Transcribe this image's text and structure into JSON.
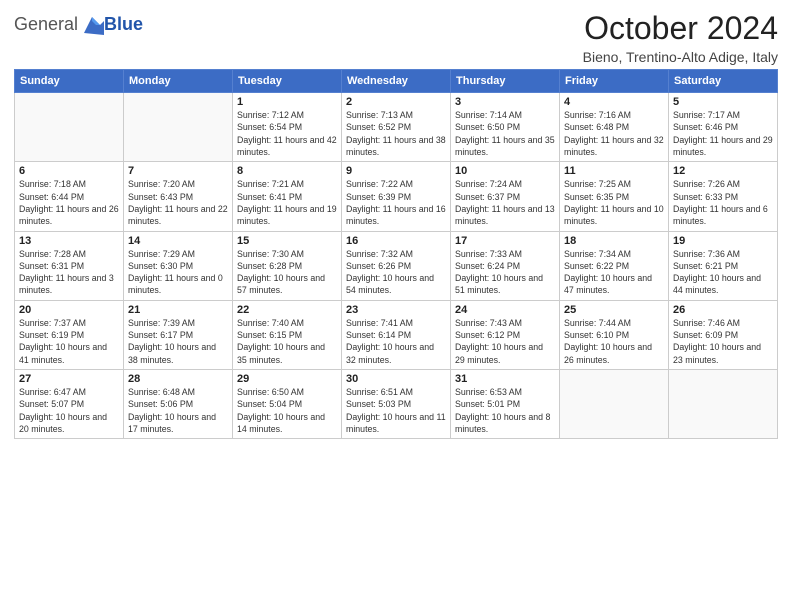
{
  "header": {
    "logo": {
      "text_general": "General",
      "text_blue": "Blue"
    },
    "month_title": "October 2024",
    "location": "Bieno, Trentino-Alto Adige, Italy"
  },
  "weekdays": [
    "Sunday",
    "Monday",
    "Tuesday",
    "Wednesday",
    "Thursday",
    "Friday",
    "Saturday"
  ],
  "weeks": [
    [
      {
        "day": "",
        "detail": ""
      },
      {
        "day": "",
        "detail": ""
      },
      {
        "day": "1",
        "detail": "Sunrise: 7:12 AM\nSunset: 6:54 PM\nDaylight: 11 hours and 42 minutes."
      },
      {
        "day": "2",
        "detail": "Sunrise: 7:13 AM\nSunset: 6:52 PM\nDaylight: 11 hours and 38 minutes."
      },
      {
        "day": "3",
        "detail": "Sunrise: 7:14 AM\nSunset: 6:50 PM\nDaylight: 11 hours and 35 minutes."
      },
      {
        "day": "4",
        "detail": "Sunrise: 7:16 AM\nSunset: 6:48 PM\nDaylight: 11 hours and 32 minutes."
      },
      {
        "day": "5",
        "detail": "Sunrise: 7:17 AM\nSunset: 6:46 PM\nDaylight: 11 hours and 29 minutes."
      }
    ],
    [
      {
        "day": "6",
        "detail": "Sunrise: 7:18 AM\nSunset: 6:44 PM\nDaylight: 11 hours and 26 minutes."
      },
      {
        "day": "7",
        "detail": "Sunrise: 7:20 AM\nSunset: 6:43 PM\nDaylight: 11 hours and 22 minutes."
      },
      {
        "day": "8",
        "detail": "Sunrise: 7:21 AM\nSunset: 6:41 PM\nDaylight: 11 hours and 19 minutes."
      },
      {
        "day": "9",
        "detail": "Sunrise: 7:22 AM\nSunset: 6:39 PM\nDaylight: 11 hours and 16 minutes."
      },
      {
        "day": "10",
        "detail": "Sunrise: 7:24 AM\nSunset: 6:37 PM\nDaylight: 11 hours and 13 minutes."
      },
      {
        "day": "11",
        "detail": "Sunrise: 7:25 AM\nSunset: 6:35 PM\nDaylight: 11 hours and 10 minutes."
      },
      {
        "day": "12",
        "detail": "Sunrise: 7:26 AM\nSunset: 6:33 PM\nDaylight: 11 hours and 6 minutes."
      }
    ],
    [
      {
        "day": "13",
        "detail": "Sunrise: 7:28 AM\nSunset: 6:31 PM\nDaylight: 11 hours and 3 minutes."
      },
      {
        "day": "14",
        "detail": "Sunrise: 7:29 AM\nSunset: 6:30 PM\nDaylight: 11 hours and 0 minutes."
      },
      {
        "day": "15",
        "detail": "Sunrise: 7:30 AM\nSunset: 6:28 PM\nDaylight: 10 hours and 57 minutes."
      },
      {
        "day": "16",
        "detail": "Sunrise: 7:32 AM\nSunset: 6:26 PM\nDaylight: 10 hours and 54 minutes."
      },
      {
        "day": "17",
        "detail": "Sunrise: 7:33 AM\nSunset: 6:24 PM\nDaylight: 10 hours and 51 minutes."
      },
      {
        "day": "18",
        "detail": "Sunrise: 7:34 AM\nSunset: 6:22 PM\nDaylight: 10 hours and 47 minutes."
      },
      {
        "day": "19",
        "detail": "Sunrise: 7:36 AM\nSunset: 6:21 PM\nDaylight: 10 hours and 44 minutes."
      }
    ],
    [
      {
        "day": "20",
        "detail": "Sunrise: 7:37 AM\nSunset: 6:19 PM\nDaylight: 10 hours and 41 minutes."
      },
      {
        "day": "21",
        "detail": "Sunrise: 7:39 AM\nSunset: 6:17 PM\nDaylight: 10 hours and 38 minutes."
      },
      {
        "day": "22",
        "detail": "Sunrise: 7:40 AM\nSunset: 6:15 PM\nDaylight: 10 hours and 35 minutes."
      },
      {
        "day": "23",
        "detail": "Sunrise: 7:41 AM\nSunset: 6:14 PM\nDaylight: 10 hours and 32 minutes."
      },
      {
        "day": "24",
        "detail": "Sunrise: 7:43 AM\nSunset: 6:12 PM\nDaylight: 10 hours and 29 minutes."
      },
      {
        "day": "25",
        "detail": "Sunrise: 7:44 AM\nSunset: 6:10 PM\nDaylight: 10 hours and 26 minutes."
      },
      {
        "day": "26",
        "detail": "Sunrise: 7:46 AM\nSunset: 6:09 PM\nDaylight: 10 hours and 23 minutes."
      }
    ],
    [
      {
        "day": "27",
        "detail": "Sunrise: 6:47 AM\nSunset: 5:07 PM\nDaylight: 10 hours and 20 minutes."
      },
      {
        "day": "28",
        "detail": "Sunrise: 6:48 AM\nSunset: 5:06 PM\nDaylight: 10 hours and 17 minutes."
      },
      {
        "day": "29",
        "detail": "Sunrise: 6:50 AM\nSunset: 5:04 PM\nDaylight: 10 hours and 14 minutes."
      },
      {
        "day": "30",
        "detail": "Sunrise: 6:51 AM\nSunset: 5:03 PM\nDaylight: 10 hours and 11 minutes."
      },
      {
        "day": "31",
        "detail": "Sunrise: 6:53 AM\nSunset: 5:01 PM\nDaylight: 10 hours and 8 minutes."
      },
      {
        "day": "",
        "detail": ""
      },
      {
        "day": "",
        "detail": ""
      }
    ]
  ]
}
